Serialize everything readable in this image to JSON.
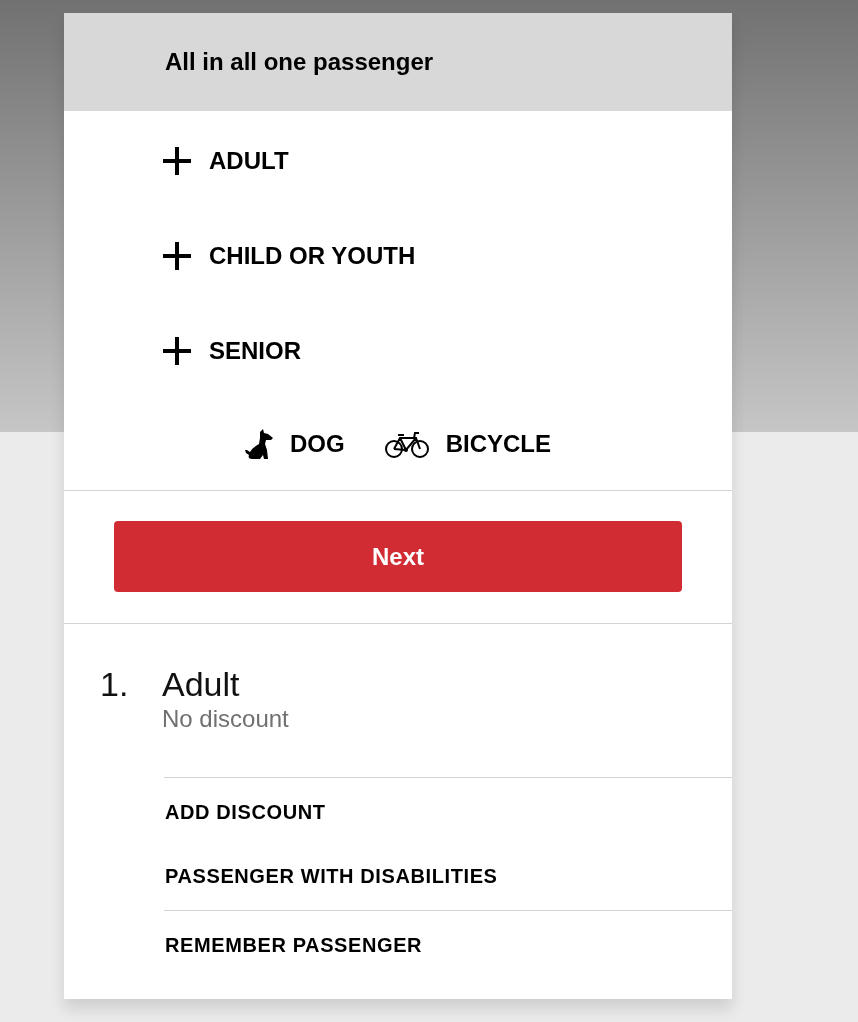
{
  "header": {
    "title": "All in all one passenger"
  },
  "passenger_types": [
    {
      "label": "ADULT"
    },
    {
      "label": "CHILD OR YOUTH"
    },
    {
      "label": "SENIOR"
    }
  ],
  "extras": [
    {
      "kind": "dog",
      "label": "DOG"
    },
    {
      "kind": "bicycle",
      "label": "BICYCLE"
    }
  ],
  "next_button": {
    "label": "Next"
  },
  "passengers": [
    {
      "number": "1.",
      "type": "Adult",
      "discount": "No discount",
      "action_groups": [
        [
          "ADD DISCOUNT",
          "PASSENGER WITH DISABILITIES"
        ],
        [
          "REMEMBER PASSENGER"
        ]
      ]
    }
  ]
}
